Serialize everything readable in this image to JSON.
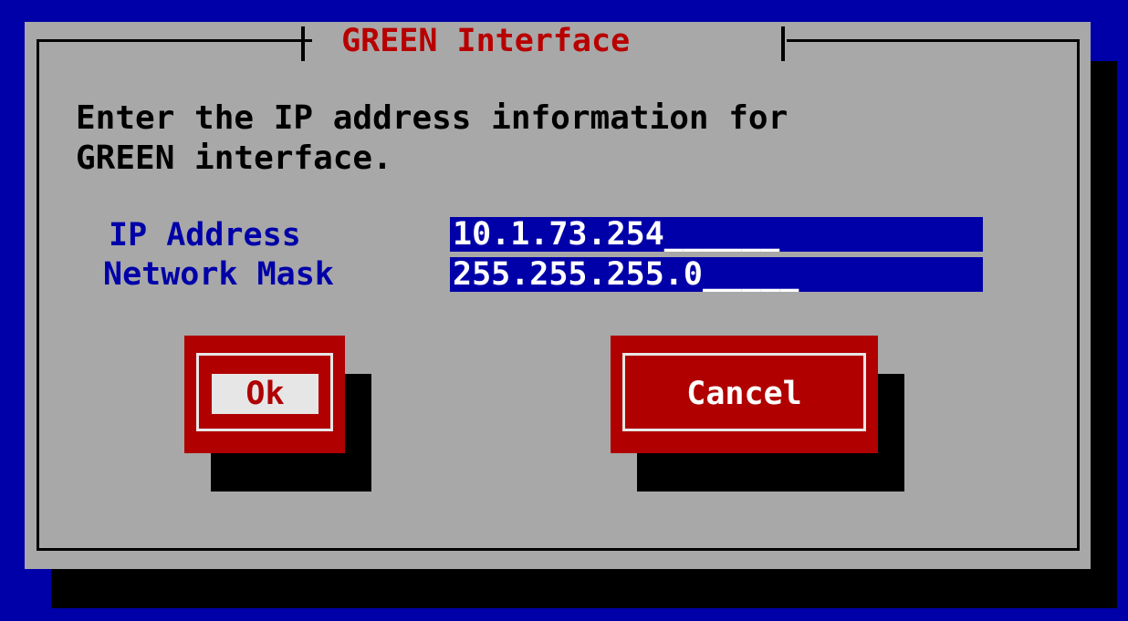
{
  "dialog": {
    "title": " GREEN Interface ",
    "prompt": "Enter the IP address information for\nGREEN interface."
  },
  "fields": {
    "ip_address": {
      "label": "IP Address",
      "value": "10.1.73.254",
      "filler": "______"
    },
    "network_mask": {
      "label": "Network Mask",
      "value": "255.255.255.0",
      "filler": "_____"
    }
  },
  "buttons": {
    "ok_label": "Ok",
    "cancel_label": "Cancel"
  },
  "colors": {
    "screen_background": "#0000a8",
    "dialog_background": "#a8a8a8",
    "title_text": "#b80000",
    "label_text": "#0000a8",
    "input_background": "#0000a8",
    "input_text": "#ffffff",
    "button_background": "#b00000",
    "focused_button_label": "#e6e6e6"
  }
}
